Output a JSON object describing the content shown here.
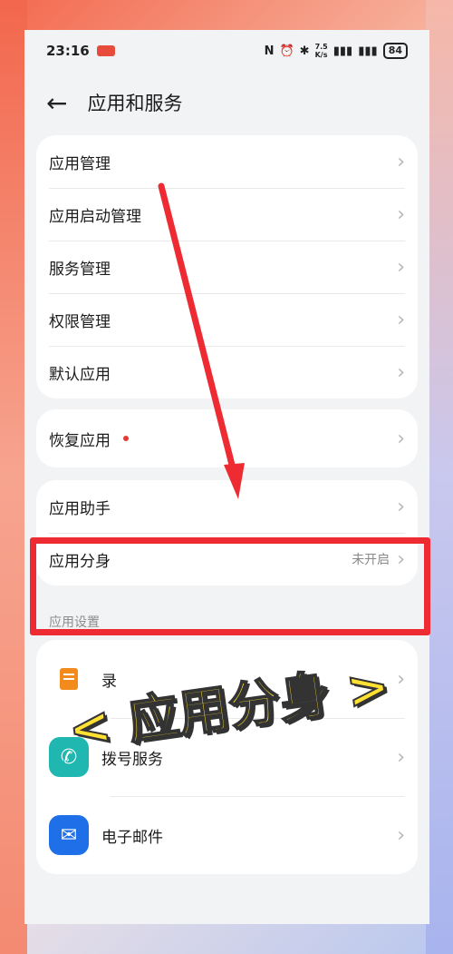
{
  "status_bar": {
    "time": "23:16",
    "net_speed": "7.5\nK/s",
    "battery": "84"
  },
  "header": {
    "title": "应用和服务"
  },
  "group1": [
    {
      "label": "应用管理"
    },
    {
      "label": "应用启动管理"
    },
    {
      "label": "服务管理"
    },
    {
      "label": "权限管理"
    },
    {
      "label": "默认应用"
    }
  ],
  "group2": [
    {
      "label": "恢复应用"
    }
  ],
  "group3": [
    {
      "label": "应用助手"
    },
    {
      "label": "应用分身",
      "value": "未开启"
    }
  ],
  "section": {
    "label": "应用设置"
  },
  "apps": [
    {
      "label": "录",
      "icon": "notes-icon"
    },
    {
      "label": "拨号服务",
      "icon": "phone-icon"
    },
    {
      "label": "电子邮件",
      "icon": "mail-icon"
    }
  ],
  "overlay": {
    "text": "< 应用分身 >"
  },
  "colors": {
    "highlight": "#ee2b32",
    "overlay_text": "#ffe033"
  }
}
